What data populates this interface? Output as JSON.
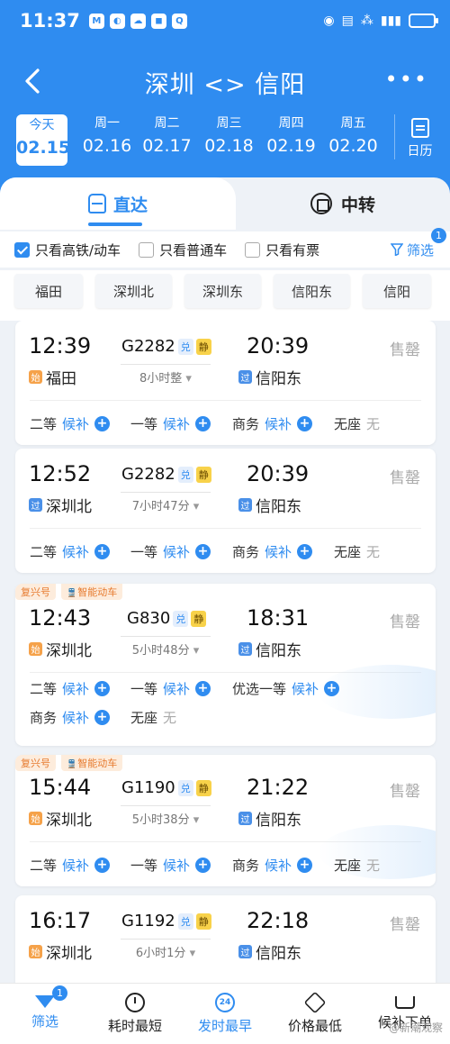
{
  "status": {
    "time": "11:37",
    "apps": [
      "M",
      "◐",
      "☁",
      "◼",
      "Q"
    ]
  },
  "nav": {
    "title": "深圳 <> 信阳",
    "more": "•••"
  },
  "dates": [
    {
      "weekday": "今天",
      "date": "02.15"
    },
    {
      "weekday": "周一",
      "date": "02.16"
    },
    {
      "weekday": "周二",
      "date": "02.17"
    },
    {
      "weekday": "周三",
      "date": "02.18"
    },
    {
      "weekday": "周四",
      "date": "02.19"
    },
    {
      "weekday": "周五",
      "date": "02.20"
    }
  ],
  "calendar_label": "日历",
  "tabs": {
    "direct": "直达",
    "transfer": "中转"
  },
  "filters": {
    "high_speed": "只看高铁/动车",
    "normal": "只看普通车",
    "available": "只看有票",
    "filter_label": "筛选",
    "filter_count": "1"
  },
  "stations": [
    "福田",
    "深圳北",
    "深圳东",
    "信阳东",
    "信阳"
  ],
  "trains": [
    {
      "tags": [],
      "dep_time": "12:39",
      "train_no": "G2282",
      "dui": "兑",
      "jing": "静",
      "arr_time": "20:39",
      "duration": "8小时整",
      "dep_badge": "始",
      "dep_station": "福田",
      "arr_badge": "过",
      "arr_station": "信阳东",
      "status": "售罄",
      "seats": [
        {
          "cls": "二等",
          "state": "候补",
          "plus": true
        },
        {
          "cls": "一等",
          "state": "候补",
          "plus": true
        },
        {
          "cls": "商务",
          "state": "候补",
          "plus": true
        },
        {
          "cls": "无座",
          "state": "无",
          "plus": false
        }
      ]
    },
    {
      "tags": [],
      "dep_time": "12:52",
      "train_no": "G2282",
      "dui": "兑",
      "jing": "静",
      "arr_time": "20:39",
      "duration": "7小时47分",
      "dep_badge": "过",
      "dep_station": "深圳北",
      "arr_badge": "过",
      "arr_station": "信阳东",
      "status": "售罄",
      "seats": [
        {
          "cls": "二等",
          "state": "候补",
          "plus": true
        },
        {
          "cls": "一等",
          "state": "候补",
          "plus": true
        },
        {
          "cls": "商务",
          "state": "候补",
          "plus": true
        },
        {
          "cls": "无座",
          "state": "无",
          "plus": false
        }
      ]
    },
    {
      "tags": [
        "复兴号",
        "智能动车"
      ],
      "dep_time": "12:43",
      "train_no": "G830",
      "dui": "兑",
      "jing": "静",
      "arr_time": "18:31",
      "duration": "5小时48分",
      "dep_badge": "始",
      "dep_station": "深圳北",
      "arr_badge": "过",
      "arr_station": "信阳东",
      "status": "售罄",
      "seats": [
        {
          "cls": "二等",
          "state": "候补",
          "plus": true
        },
        {
          "cls": "一等",
          "state": "候补",
          "plus": true
        },
        {
          "cls": "优选一等",
          "state": "候补",
          "plus": true
        },
        {
          "cls": "商务",
          "state": "候补",
          "plus": true
        },
        {
          "cls": "无座",
          "state": "无",
          "plus": false
        }
      ]
    },
    {
      "tags": [
        "复兴号",
        "智能动车"
      ],
      "dep_time": "15:44",
      "train_no": "G1190",
      "dui": "兑",
      "jing": "静",
      "arr_time": "21:22",
      "duration": "5小时38分",
      "dep_badge": "始",
      "dep_station": "深圳北",
      "arr_badge": "过",
      "arr_station": "信阳东",
      "status": "售罄",
      "seats": [
        {
          "cls": "二等",
          "state": "候补",
          "plus": true
        },
        {
          "cls": "一等",
          "state": "候补",
          "plus": true
        },
        {
          "cls": "商务",
          "state": "候补",
          "plus": true
        },
        {
          "cls": "无座",
          "state": "无",
          "plus": false
        }
      ]
    },
    {
      "tags": [],
      "dep_time": "16:17",
      "train_no": "G1192",
      "dui": "兑",
      "jing": "静",
      "arr_time": "22:18",
      "duration": "6小时1分",
      "dep_badge": "始",
      "dep_station": "深圳北",
      "arr_badge": "过",
      "arr_station": "信阳东",
      "status": "售罄",
      "seats": []
    }
  ],
  "bottom": {
    "filter": "筛选",
    "filter_count": "1",
    "shortest": "耗时最短",
    "earliest": "发时最早",
    "earliest_icon": "24",
    "cheapest": "价格最低",
    "waitlist": "候补下单",
    "watermark": "@新潮观察"
  },
  "colors": {
    "primary": "#2f8cf0",
    "orange": "#f5a24a",
    "sold": "#aaaaaa"
  }
}
